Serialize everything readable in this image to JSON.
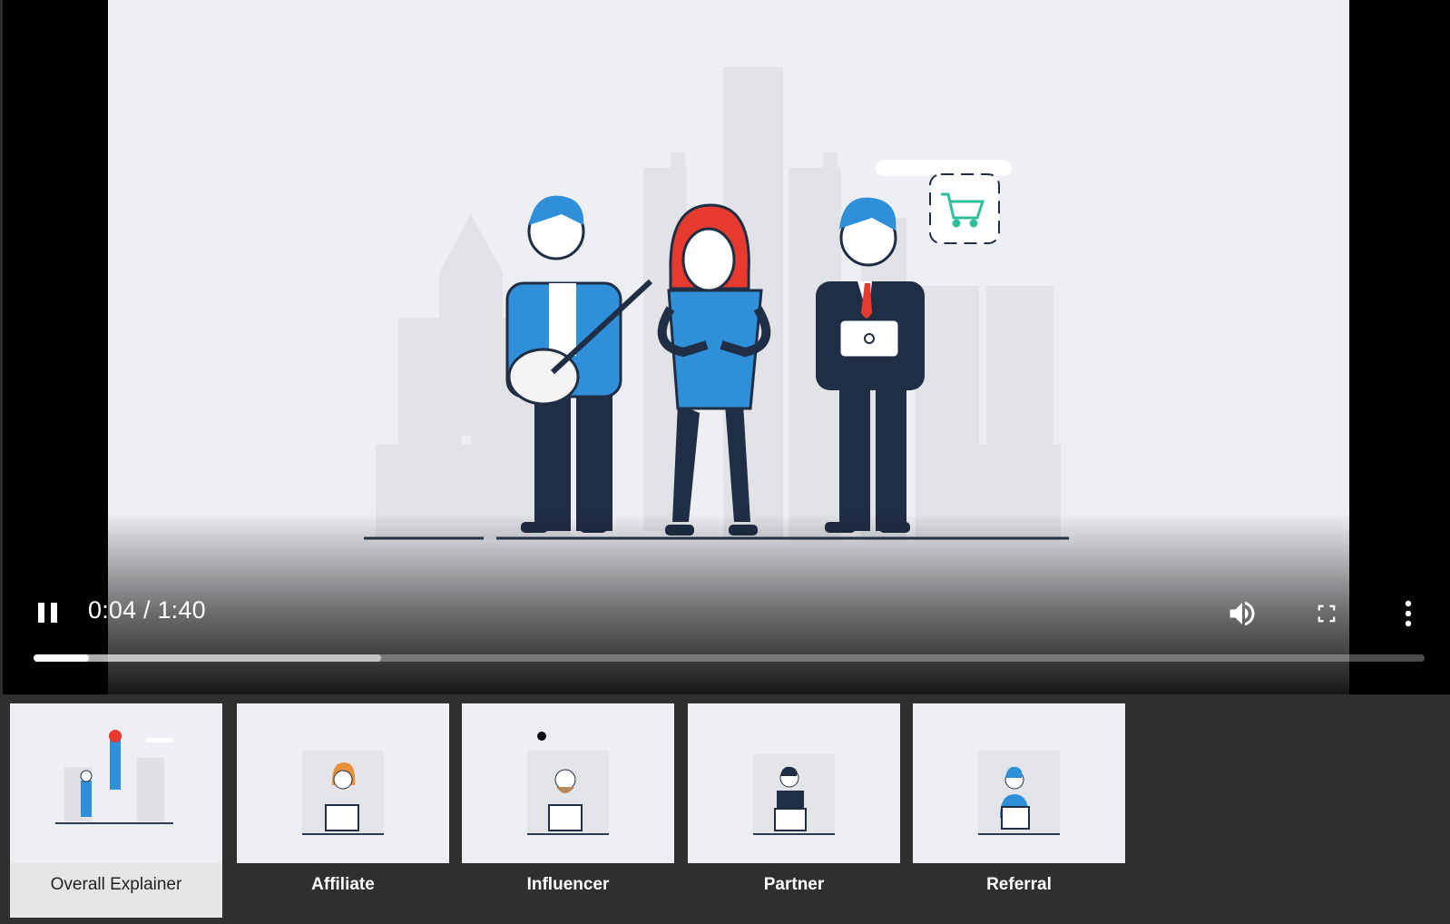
{
  "player": {
    "time_display": "0:04 / 1:40",
    "progress_played": 0.04,
    "progress_buffered": 0.25,
    "controls": {
      "play_state_icon": "pause-icon",
      "volume_icon": "volume-icon",
      "fullscreen_icon": "fullscreen-icon",
      "more_icon": "more-vert-icon"
    }
  },
  "playlist": {
    "items": [
      {
        "label": "Overall Explainer",
        "active": true
      },
      {
        "label": "Affiliate",
        "active": false
      },
      {
        "label": "Influencer",
        "active": false
      },
      {
        "label": "Partner",
        "active": false
      },
      {
        "label": "Referral",
        "active": false
      }
    ]
  },
  "colors": {
    "stage_background": "#eeeff3",
    "accent_blue": "#2f8fd8",
    "accent_red": "#e63a2e",
    "navy": "#1f2d45",
    "cart_green": "#2fbf9a"
  }
}
